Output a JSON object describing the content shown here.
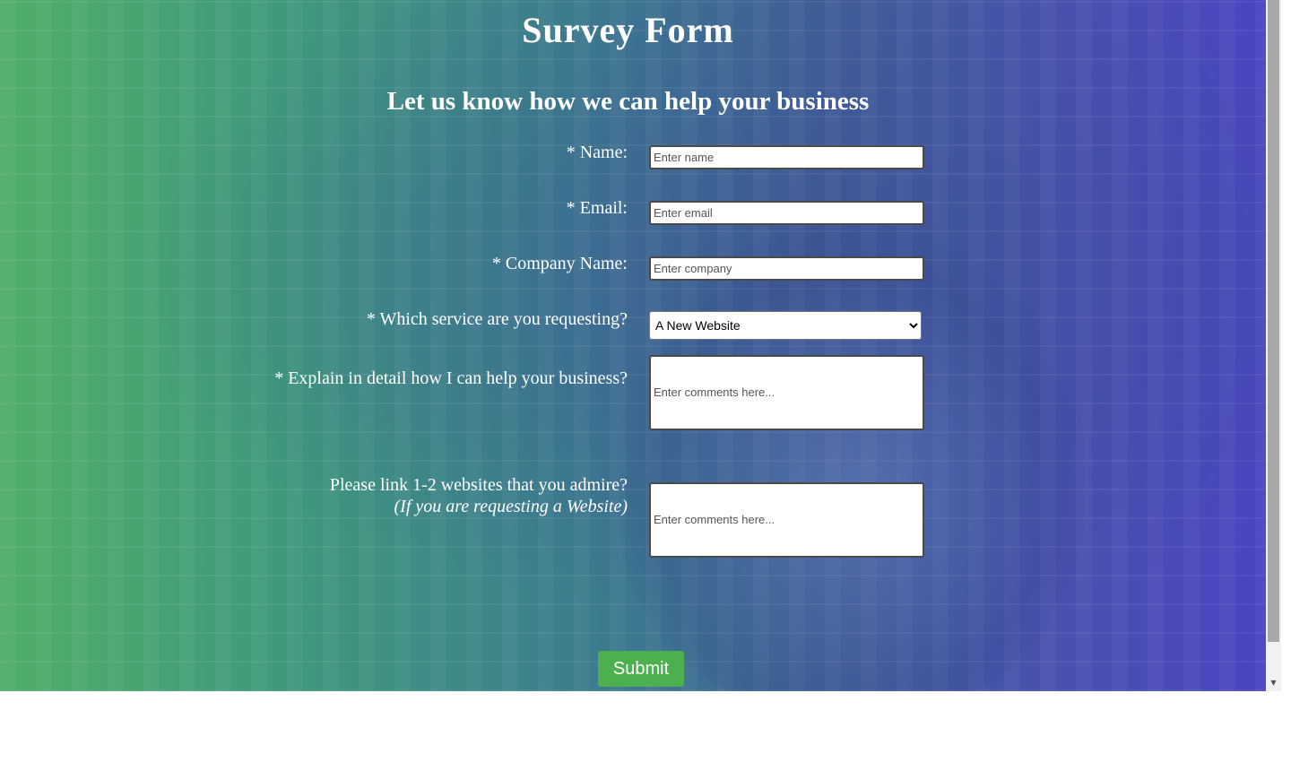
{
  "page": {
    "title": "Survey Form",
    "subtitle": "Let us know how we can help your business"
  },
  "form": {
    "name": {
      "label": "* Name:",
      "placeholder": "Enter name",
      "value": ""
    },
    "email": {
      "label": "* Email:",
      "placeholder": "Enter email",
      "value": ""
    },
    "company": {
      "label": "* Company Name:",
      "placeholder": "Enter company",
      "value": ""
    },
    "service": {
      "label": "* Which service are you requesting?",
      "selected": "A New Website"
    },
    "details": {
      "label": "* Explain in detail how I can help your business?",
      "placeholder": "Enter comments here..."
    },
    "websites": {
      "label": "Please link 1-2 websites that you admire?",
      "sublabel": "(If you are requesting a Website)",
      "placeholder": "Enter comments here..."
    },
    "submit_label": "Submit"
  },
  "colors": {
    "submit_button": "#4caf50",
    "text": "#ffffff"
  }
}
